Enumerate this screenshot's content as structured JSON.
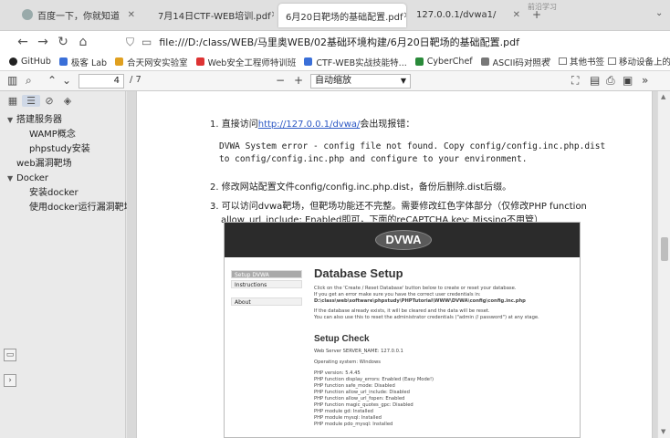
{
  "tabs": [
    {
      "title": "百度一下，你就知道",
      "icon": "baidu-icon"
    },
    {
      "title": "7月14日CTF-WEB培训.pdf",
      "icon": "pdf-icon"
    },
    {
      "title": "6月20日靶场的基础配置.pdf",
      "icon": "pdf-icon",
      "active": true
    },
    {
      "title": "127.0.0.1/dvwa1/",
      "icon": "globe-icon"
    }
  ],
  "watermark": "前沿学习",
  "address": {
    "url": "file:///D:/class/WEB/马里奥WEB/02基础环境构建/6月20日靶场的基础配置.pdf"
  },
  "bookmarks": [
    "GitHub",
    "极客 Lab",
    "合天网安实验室",
    "Web安全工程师特训班",
    "CTF-WEB实战技能特...",
    "CyberChef",
    "ASCII码对照表"
  ],
  "bookmarks_right": [
    "其他书签",
    "移动设备上的书签"
  ],
  "pdf_toolbar": {
    "page_current": "4",
    "page_total": "/ 7",
    "zoom": "自动缩放"
  },
  "outline": [
    {
      "label": "搭建服务器",
      "level": 0,
      "expanded": true
    },
    {
      "label": "WAMP概念",
      "level": 2
    },
    {
      "label": "phpstudy安装",
      "level": 2
    },
    {
      "label": "web漏洞靶场",
      "level": 0
    },
    {
      "label": "Docker",
      "level": 0,
      "expanded": true
    },
    {
      "label": "安装docker",
      "level": 1
    },
    {
      "label": "使用docker运行漏洞靶场",
      "level": 1
    }
  ],
  "doc": {
    "item1_prefix": "1. 直接访问",
    "item1_link": "http://127.0.0.1/dvwa/",
    "item1_suffix": "会出现报错：",
    "error_line1": "DVWA System error - config file not found. Copy config/config.inc.php.dist",
    "error_line2": "to config/config.inc.php and configure to your environment.",
    "item2": "2. 修改网站配置文件config/config.inc.php.dist，备份后删除.dist后缀。",
    "item3_line1": "3. 可以访问dvwa靶场，但靶场功能还不完整。需要修改红色字体部分（仅修改PHP function",
    "item3_line2": "allow_url_include: Enabled即可，下面的reCAPTCHA key: Missing不用管）"
  },
  "dvwa": {
    "logo": "DVWA",
    "nav": [
      "Setup DVWA",
      "Instructions",
      "About"
    ],
    "title": "Database Setup",
    "intro": [
      "Click on the 'Create / Reset Database' button below to create or reset your database.",
      "If you get an error make sure you have the correct user credentials in:",
      "D:\\class\\web\\software\\phpstudy\\PHPTutorial\\WWW\\DVWA\\config\\config.inc.php",
      "If the database already exists, it will be cleared and the data will be reset.",
      "You can also use this to reset the administrator credentials (\"admin // password\") at any stage."
    ],
    "check_title": "Setup Check",
    "check_lines": [
      "Web Server SERVER_NAME: 127.0.0.1",
      "Operating system: Windows",
      "PHP version: 5.4.45",
      "PHP function display_errors: Enabled (Easy Mode!)",
      "PHP function safe_mode: Disabled",
      "PHP function allow_url_include: Disabled",
      "PHP function allow_url_fopen: Enabled",
      "PHP function magic_quotes_gpc: Disabled",
      "PHP module gd: Installed",
      "PHP module mysql: Installed",
      "PHP module pdo_mysql: Installed"
    ]
  }
}
